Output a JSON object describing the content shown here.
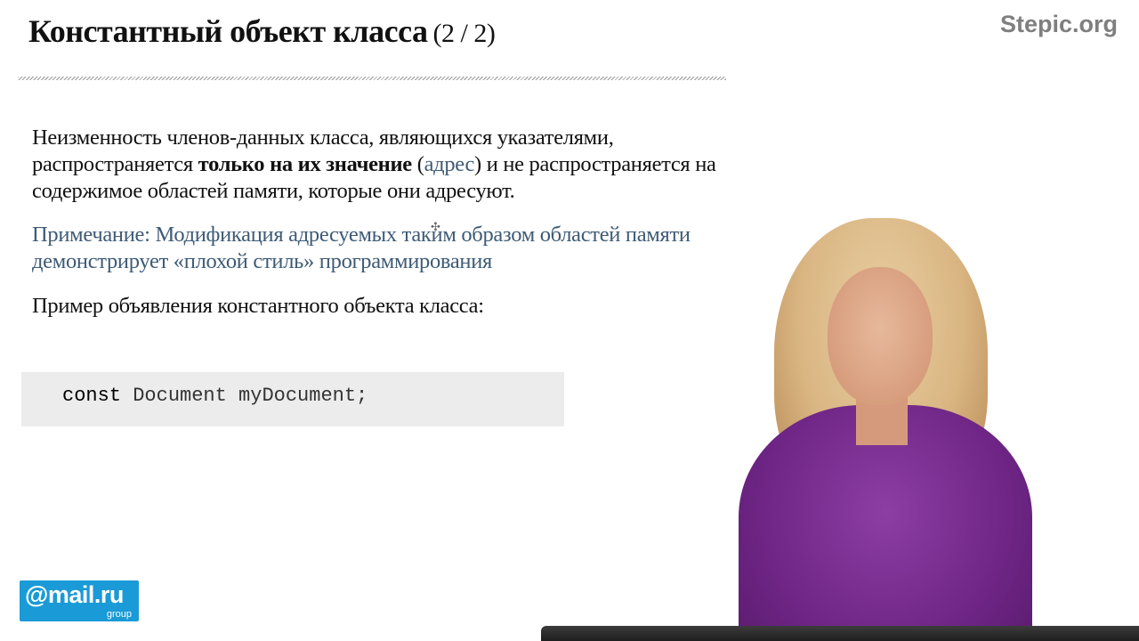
{
  "slide": {
    "title": "Константный объект класса",
    "pager": "(2 / 2)",
    "p1_before": "Неизменность членов-данных класса, являющихся указателями, распространяется ",
    "p1_bold": "только на их значение",
    "p1_paren_open": " (",
    "p1_accent": "адрес",
    "p1_after": ") и не распространяется на содержимое областей памяти, которые они адресуют.",
    "note": "Примечание: Модификация адресуемых таким образом областей памяти демонстрирует «плохой стиль» программирования",
    "example_label": "Пример объявления константного объекта класса:",
    "code_keyword": "const",
    "code_rest": " Document myDocument;"
  },
  "brand": "Stepic.org",
  "logo": {
    "main": "@mail.ru",
    "sub": "group"
  },
  "cursor_glyph": "✣",
  "colors": {
    "accent": "#3e5b76",
    "logo_bg": "#1a9ad6",
    "brand": "#7f7f7f",
    "code_bg": "#ececec"
  }
}
